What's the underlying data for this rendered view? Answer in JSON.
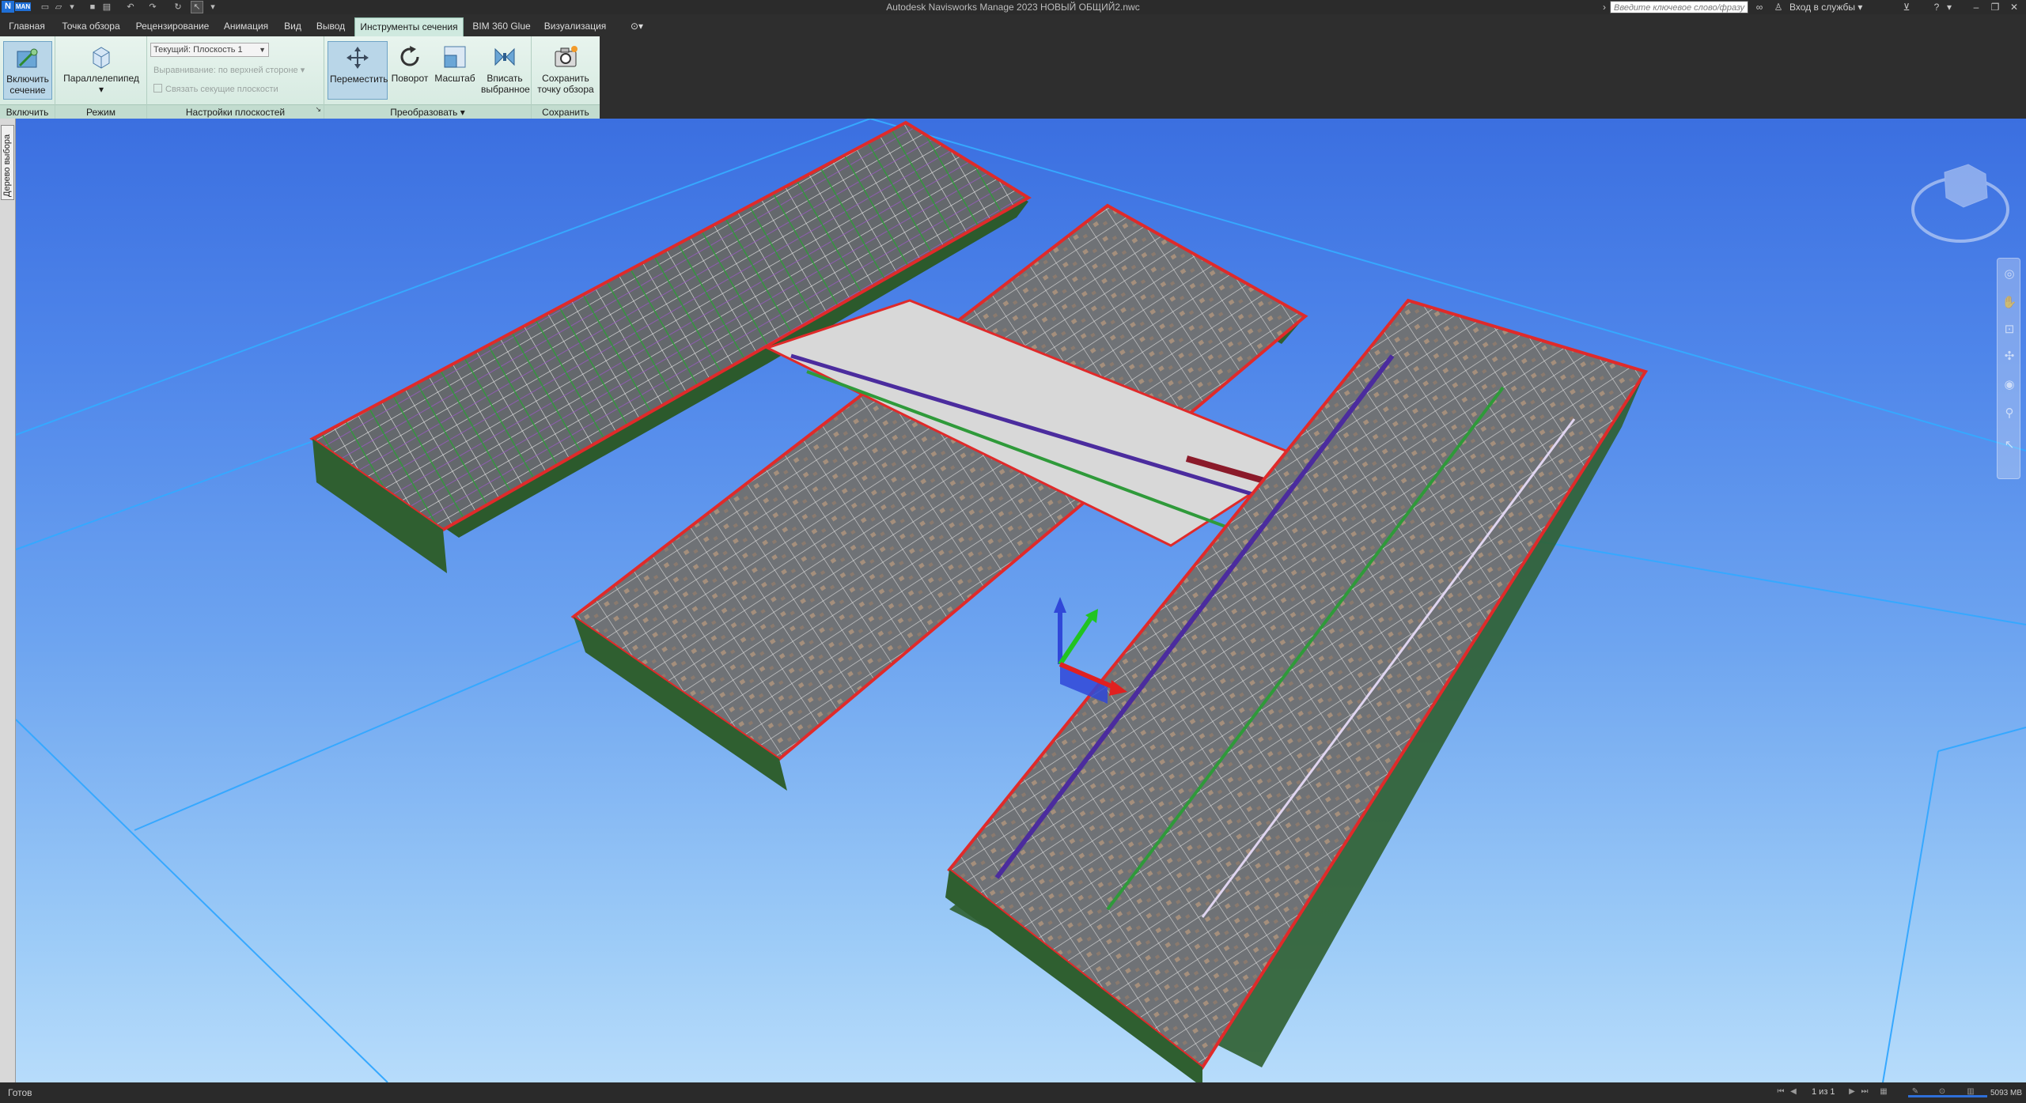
{
  "title_bar": {
    "app_badge": "N",
    "app_badge_tag": "MAN",
    "title": "Autodesk Navisworks Manage 2023   НОВЫЙ ОБЩИЙ2.nwc",
    "search_placeholder": "Введите ключевое слово/фразу",
    "login_label": "Вход в службы",
    "login_caret": "▾",
    "icons": [
      "new-icon",
      "open-icon",
      "save-icon",
      "print-icon",
      "undo-icon",
      "redo-icon",
      "refresh-icon",
      "select-icon"
    ]
  },
  "tabs": [
    {
      "label": "Главная",
      "active": false
    },
    {
      "label": "Точка обзора",
      "active": false
    },
    {
      "label": "Рецензирование",
      "active": false
    },
    {
      "label": "Анимация",
      "active": false
    },
    {
      "label": "Вид",
      "active": false
    },
    {
      "label": "Вывод",
      "active": false
    },
    {
      "label": "Инструменты сечения",
      "active": true
    },
    {
      "label": "BIM 360 Glue",
      "active": false
    },
    {
      "label": "Визуализация",
      "active": false
    }
  ],
  "ribbon": {
    "enable": {
      "button_label": "Включить сечение",
      "panel_label": "Включить"
    },
    "mode": {
      "button_label": "Параллелепипед",
      "panel_label": "Режим"
    },
    "planes": {
      "current_plane": "Текущий: Плоскость 1",
      "align_label": "Выравнивание: по верхней стороне",
      "link_label": "Связать секущие плоскости",
      "panel_label": "Настройки плоскостей"
    },
    "transform": {
      "move_label": "Переместить",
      "rotate_label": "Поворот",
      "scale_label": "Масштаб",
      "fit_label": "Вписать выбранное",
      "panel_label": "Преобразовать ▾"
    },
    "save": {
      "button_label": "Сохранить точку обзора",
      "panel_label": "Сохранить"
    }
  },
  "left_dock": {
    "tab_label": "Дерево выбора"
  },
  "status_bar": {
    "status": "Готов",
    "page": "1 из 1",
    "memory": "5093 MB"
  },
  "colors": {
    "active_tab": "#cfe9df",
    "ribbon_bg": "#dcefe6",
    "viewport_top": "#3b6fe0",
    "viewport_bottom": "#b7dcfb",
    "gizmo_x": "#e02020",
    "gizmo_y": "#20c020",
    "gizmo_z": "#2040e0"
  }
}
